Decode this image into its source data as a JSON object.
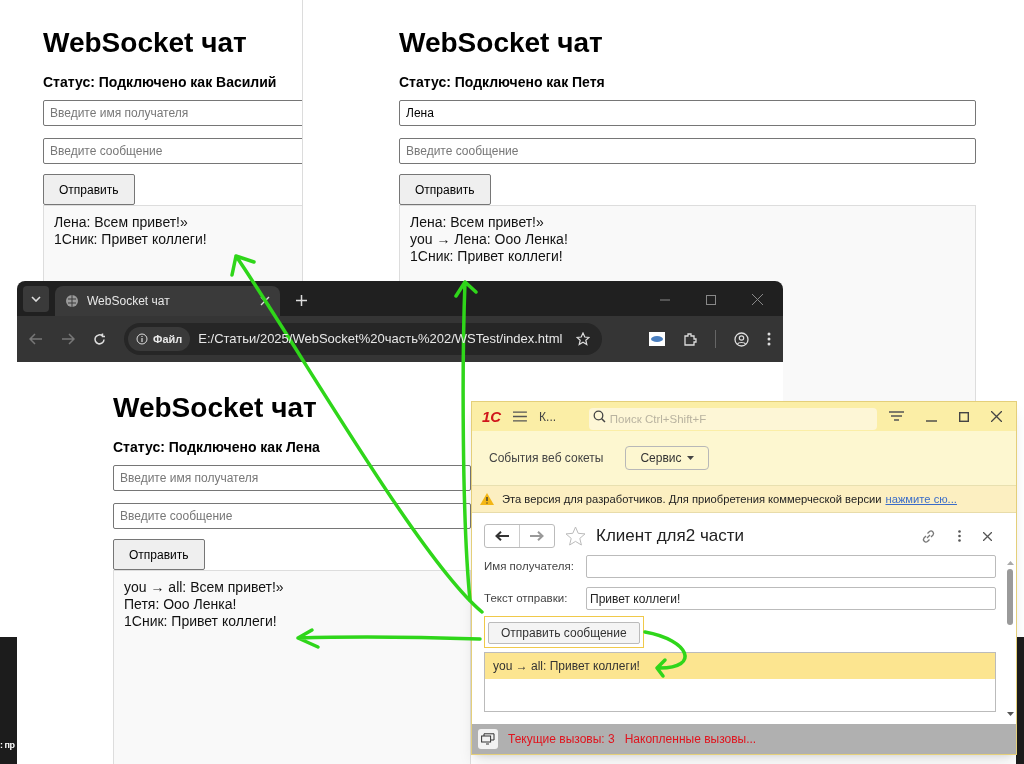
{
  "chat_pages": [
    {
      "heading": "WebSocket чат",
      "status": "Статус: Подключено как Василий",
      "recipient": {
        "placeholder": "Введите имя получателя"
      },
      "message": {
        "placeholder": "Введите сообщение"
      },
      "send_button": "Отправить",
      "messages": [
        "Лена: Всем привет!»",
        "1Сник: Привет коллеги!"
      ]
    },
    {
      "heading": "WebSocket чат",
      "status": "Статус: Подключено как Петя",
      "recipient": {
        "value": "Лена"
      },
      "message": {
        "placeholder": "Введите сообщение"
      },
      "send_button": "Отправить",
      "messages": [
        "Лена: Всем привет!»",
        "you → Лена: Ооо Ленка!",
        "1Сник: Привет коллеги!"
      ]
    },
    {
      "heading": "WebSocket чат",
      "status": "Статус: Подключено как Лена",
      "recipient": {
        "placeholder": "Введите имя получателя"
      },
      "message": {
        "placeholder": "Введите сообщение"
      },
      "send_button": "Отправить",
      "messages": [
        "you → all: Всем привет!»",
        "Петя: Ооо Ленка!",
        "1Сник: Привет коллеги!"
      ]
    }
  ],
  "browser": {
    "tab_title": "WebSocket чат",
    "site_label": "Файл",
    "url": "E:/Статьи/2025/WebSocket%20часть%202/WSTest/index.html"
  },
  "onec": {
    "logo": "1С",
    "app_title": "К...",
    "search": {
      "placeholder": "Поиск Ctrl+Shift+F"
    },
    "section": "События веб сокеты",
    "service_button": "Сервис",
    "warning": "Эта версия для разработчиков. Для приобретения коммерческой версии",
    "warning_link": "нажмите сю...",
    "form_title": "Клиент для2 части",
    "fields": [
      {
        "label": "Имя получателя:"
      },
      {
        "label": "Текст отправки:",
        "value": "Привет коллеги!"
      }
    ],
    "send_button": "Отправить сообщение",
    "log": [
      {
        "text": "you → all: Привет коллеги!",
        "selected": true
      }
    ],
    "status_items": [
      "Текущие вызовы: 3",
      "Накопленные вызовы..."
    ]
  },
  "taskbar_text": ": пр"
}
